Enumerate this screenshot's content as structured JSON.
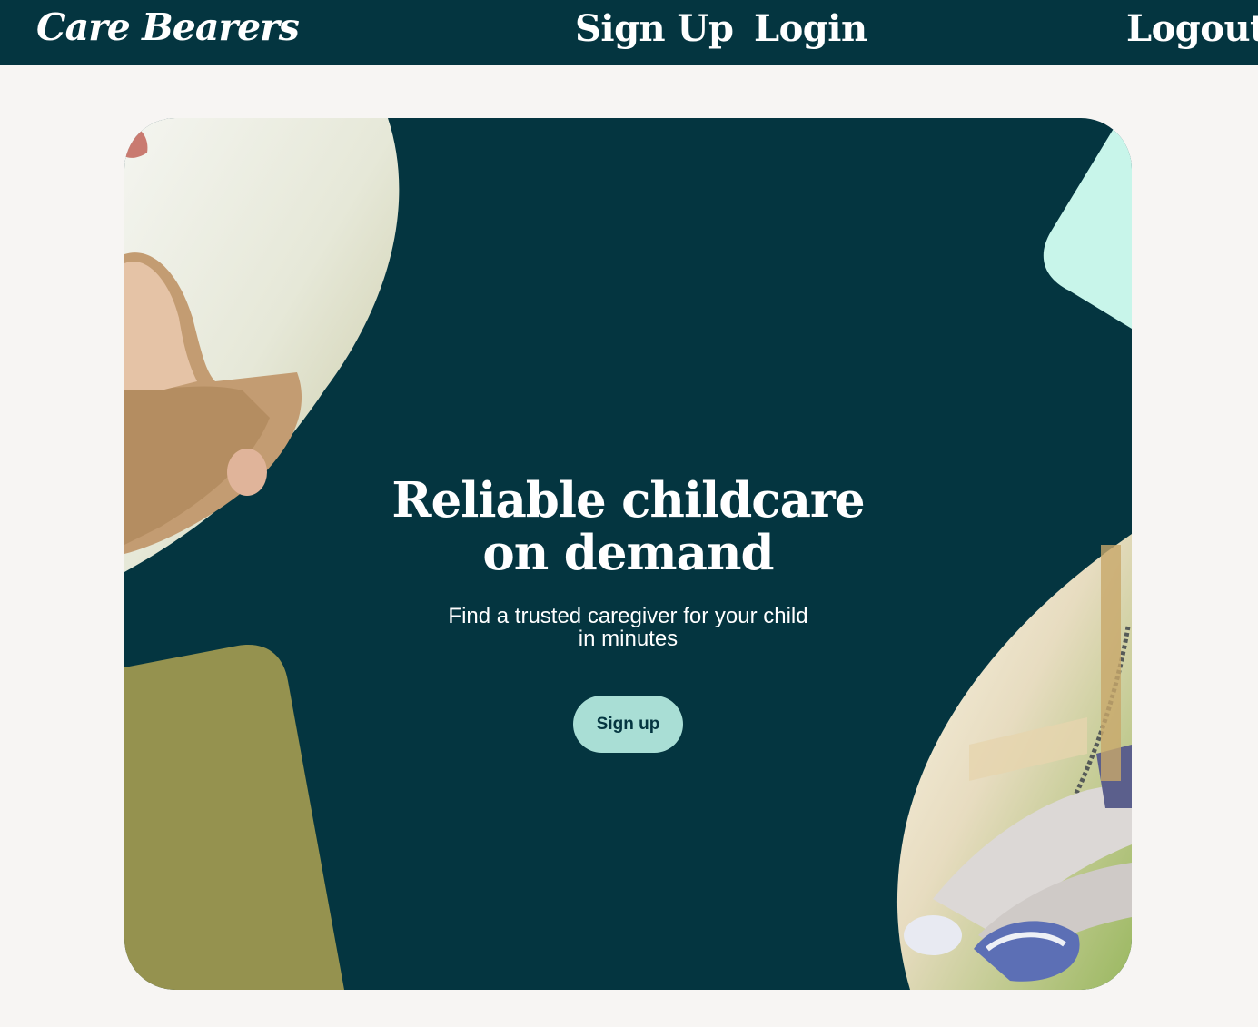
{
  "nav": {
    "brand": "Care Bearers",
    "signup": "Sign Up",
    "login": "Login",
    "logout": "Logout"
  },
  "hero": {
    "headline_line1": "Reliable childcare",
    "headline_line2": "on demand",
    "sub_line1": "Find a trusted caregiver for your child",
    "sub_line2": "in minutes",
    "cta_label": "Sign up"
  },
  "colors": {
    "navy": "#043540",
    "page_bg": "#f7f5f3",
    "mint": "#c8f5ea",
    "olive": "#95924f",
    "cta": "#a9ded5"
  }
}
